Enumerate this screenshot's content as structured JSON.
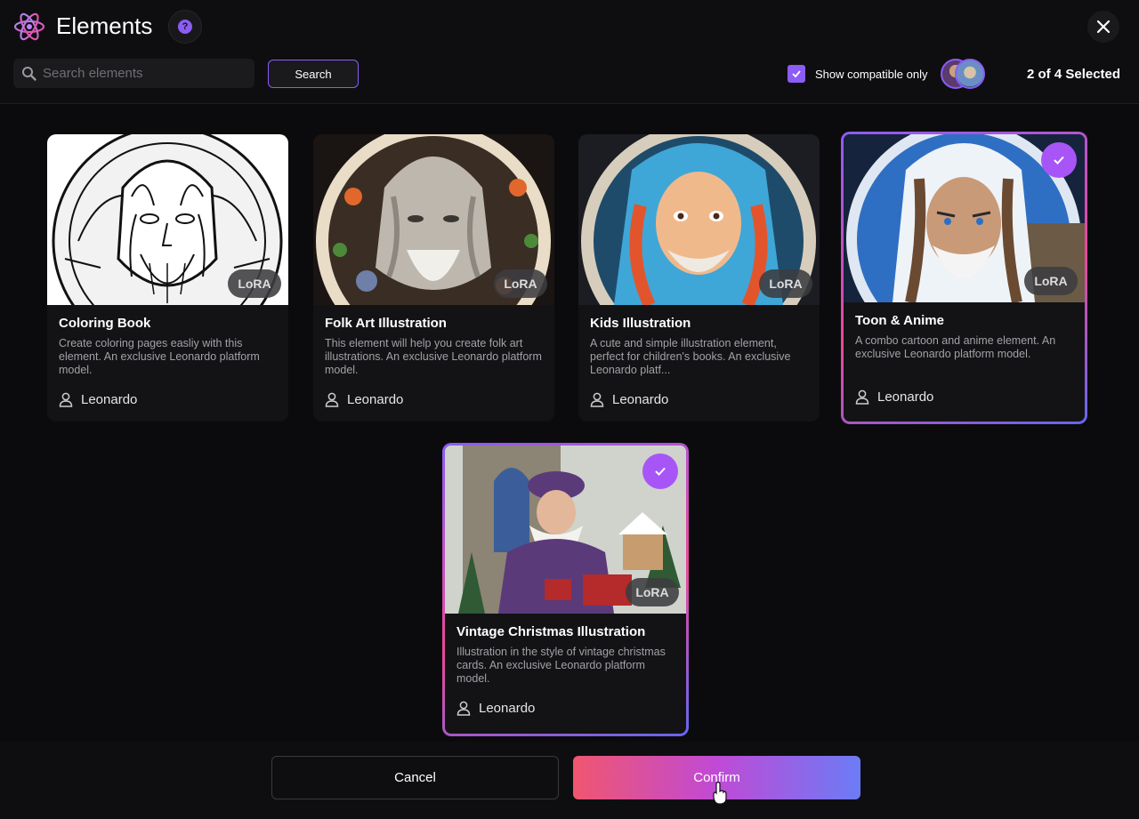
{
  "header": {
    "title": "Elements",
    "help_glyph": "?"
  },
  "search": {
    "placeholder": "Search elements",
    "value": "",
    "button_label": "Search"
  },
  "filters": {
    "compatible_label": "Show compatible only",
    "compatible_checked": true,
    "selected_count": "2 of 4 Selected"
  },
  "cards": [
    {
      "title": "Coloring Book",
      "description": "Create coloring pages easliy with this element. An exclusive Leonardo platform model.",
      "badge": "LoRA",
      "author": "Leonardo",
      "selected": false
    },
    {
      "title": "Folk Art Illustration",
      "description": "This element will help you create folk art illustrations. An exclusive Leonardo platform model.",
      "badge": "LoRA",
      "author": "Leonardo",
      "selected": false
    },
    {
      "title": "Kids Illustration",
      "description": "A cute and simple illustration element, perfect for children's books. An exclusive Leonardo platf...",
      "badge": "LoRA",
      "author": "Leonardo",
      "selected": false
    },
    {
      "title": "Toon & Anime",
      "description": "A combo cartoon and anime element. An exclusive Leonardo platform model.",
      "badge": "LoRA",
      "author": "Leonardo",
      "selected": true
    },
    {
      "title": "Vintage Christmas Illustration",
      "description": "Illustration in the style of vintage christmas cards. An exclusive Leonardo platform model.",
      "badge": "LoRA",
      "author": "Leonardo",
      "selected": true
    }
  ],
  "footer": {
    "cancel_label": "Cancel",
    "confirm_label": "Confirm"
  },
  "colors": {
    "accent": "#8b5cf6",
    "confirm_gradient_start": "#f0566f",
    "confirm_gradient_end": "#6b7cf6"
  },
  "icons": [
    "atom-logo-icon",
    "help-icon",
    "close-icon",
    "search-icon",
    "checkbox-check-icon",
    "user-icon",
    "selected-check-icon",
    "cursor-hand-icon"
  ]
}
